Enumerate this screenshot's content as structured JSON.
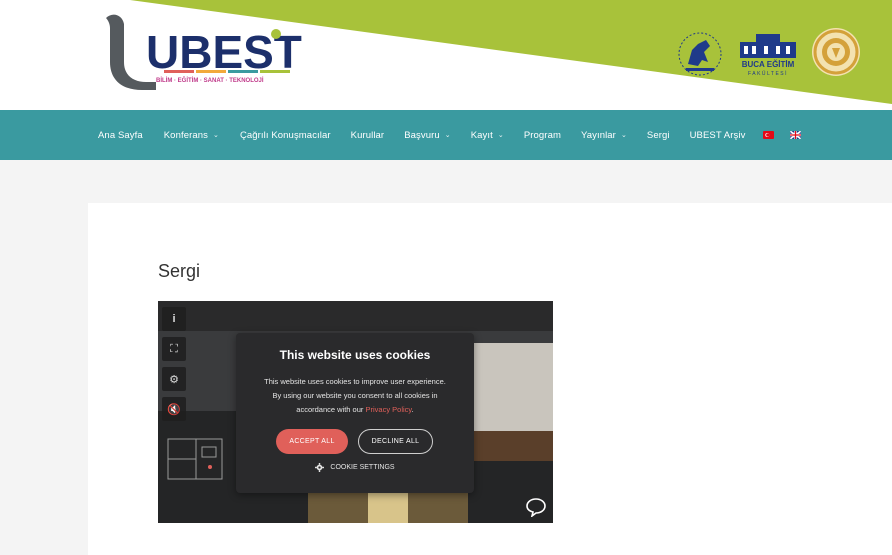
{
  "logo": {
    "wordmark": "UBEST",
    "tagline": "BİLİM · EĞİTİM · SANAT · TEKNOLOJİ"
  },
  "partners": {
    "faculty_name": "BUCA EĞİTİM",
    "faculty_sub": "FAKÜLTESİ"
  },
  "nav": {
    "items": [
      {
        "label": "Ana Sayfa",
        "dropdown": false
      },
      {
        "label": "Konferans",
        "dropdown": true
      },
      {
        "label": "Çağrılı Konuşmacılar",
        "dropdown": false
      },
      {
        "label": "Kurullar",
        "dropdown": false
      },
      {
        "label": "Başvuru",
        "dropdown": true
      },
      {
        "label": "Kayıt",
        "dropdown": true
      },
      {
        "label": "Program",
        "dropdown": false
      },
      {
        "label": "Yayınlar",
        "dropdown": true
      },
      {
        "label": "Sergi",
        "dropdown": false
      },
      {
        "label": "UBEST Arşiv",
        "dropdown": false
      }
    ],
    "flags": [
      "tr-flag",
      "uk-flag"
    ]
  },
  "page": {
    "title": "Sergi"
  },
  "cookie": {
    "title": "This website uses cookies",
    "text_line1": "This website uses cookies to improve user experience.",
    "text_line2": "By using our website you consent to all cookies in",
    "text_line3_pre": "accordance with our ",
    "text_link": "Privacy Policy",
    "text_line3_post": ".",
    "accept_label": "ACCEPT ALL",
    "decline_label": "DECLINE ALL",
    "settings_label": "COOKIE SETTINGS"
  },
  "colors": {
    "header_green": "#a8c23a",
    "nav_teal": "#3a9aa0",
    "accept": "#e0605a",
    "logo_grey": "#555a5e",
    "logo_navy": "#1c2f6b",
    "partner_navy": "#1f3a8a"
  }
}
